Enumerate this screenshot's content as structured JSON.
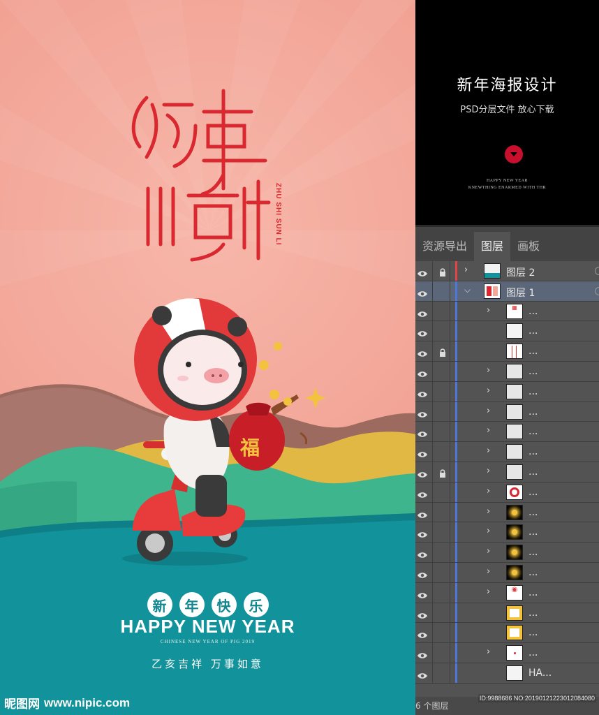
{
  "poster": {
    "title_chars": [
      "猪",
      "事",
      "顺",
      "利"
    ],
    "title_pinyin": "ZHU SHI SUN LI",
    "bag_char": "福",
    "greeting_chars": [
      "新",
      "年",
      "快",
      "乐"
    ],
    "headline": "HAPPY NEW YEAR",
    "subline": "CHINESE NEW YEAR  OF PIG 2019",
    "blessing": "乙亥吉祥  万事如意",
    "watermark_logo": "昵图网",
    "watermark_url": "www.nipic.com",
    "colors": {
      "sky": "#f3a89b",
      "sea": "#12929a",
      "accent": "#d9282f"
    }
  },
  "info": {
    "title": "新年海报设计",
    "subtitle": "PSD分层文件  放心下载",
    "eng_1": "HAPPY NEW YEAR",
    "eng_2": "KNEWTHING ENARMED WITH THR"
  },
  "layers_panel": {
    "tabs": [
      {
        "label": "资源导出",
        "active": false
      },
      {
        "label": "图层",
        "active": true
      },
      {
        "label": "画板",
        "active": false
      }
    ],
    "layers": [
      {
        "name": "图层 2",
        "depth": 0,
        "locked": true,
        "expand": "right",
        "selected": false,
        "thumb": "poster"
      },
      {
        "name": "图层 1",
        "depth": 0,
        "locked": false,
        "expand": "down",
        "selected": true,
        "thumb": "red"
      },
      {
        "name": "...",
        "depth": 1,
        "locked": false,
        "expand": "right",
        "selected": false,
        "thumb": "text"
      },
      {
        "name": "...",
        "depth": 1,
        "locked": false,
        "expand": "",
        "selected": false,
        "thumb": "white"
      },
      {
        "name": "...",
        "depth": 1,
        "locked": true,
        "expand": "",
        "selected": false,
        "thumb": "lines"
      },
      {
        "name": "...",
        "depth": 1,
        "locked": false,
        "expand": "right",
        "selected": false,
        "thumb": "gray"
      },
      {
        "name": "...",
        "depth": 1,
        "locked": false,
        "expand": "right",
        "selected": false,
        "thumb": "gray"
      },
      {
        "name": "...",
        "depth": 1,
        "locked": false,
        "expand": "right",
        "selected": false,
        "thumb": "gray"
      },
      {
        "name": "...",
        "depth": 1,
        "locked": false,
        "expand": "right",
        "selected": false,
        "thumb": "gray"
      },
      {
        "name": "...",
        "depth": 1,
        "locked": false,
        "expand": "right",
        "selected": false,
        "thumb": "gray"
      },
      {
        "name": "...",
        "depth": 1,
        "locked": true,
        "expand": "right",
        "selected": false,
        "thumb": "gray"
      },
      {
        "name": "...",
        "depth": 1,
        "locked": false,
        "expand": "right",
        "selected": false,
        "thumb": "ring"
      },
      {
        "name": "...",
        "depth": 1,
        "locked": false,
        "expand": "right",
        "selected": false,
        "thumb": "star"
      },
      {
        "name": "...",
        "depth": 1,
        "locked": false,
        "expand": "right",
        "selected": false,
        "thumb": "star"
      },
      {
        "name": "...",
        "depth": 1,
        "locked": false,
        "expand": "right",
        "selected": false,
        "thumb": "star"
      },
      {
        "name": "...",
        "depth": 1,
        "locked": false,
        "expand": "right",
        "selected": false,
        "thumb": "star"
      },
      {
        "name": "...",
        "depth": 1,
        "locked": false,
        "expand": "right",
        "selected": false,
        "thumb": "pig"
      },
      {
        "name": "...",
        "depth": 1,
        "locked": false,
        "expand": "",
        "selected": false,
        "thumb": "frame"
      },
      {
        "name": "...",
        "depth": 1,
        "locked": false,
        "expand": "",
        "selected": false,
        "thumb": "frame"
      },
      {
        "name": "...",
        "depth": 1,
        "locked": false,
        "expand": "right",
        "selected": false,
        "thumb": "dot"
      },
      {
        "name": "HA...",
        "depth": 1,
        "locked": false,
        "expand": "",
        "selected": false,
        "thumb": "white"
      }
    ],
    "footer_count": "6 个图层",
    "footer_id": "ID:9988686 NO:20190121223012084080"
  }
}
